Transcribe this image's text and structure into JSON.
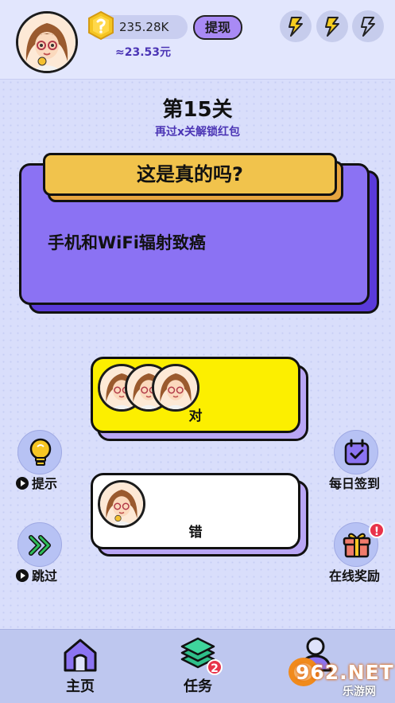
{
  "header": {
    "coin_value": "235.28K",
    "withdraw_label": "提现",
    "approx_value": "≈23.53元",
    "energy_icons": [
      "lightning-icon",
      "lightning-icon",
      "lightning-icon"
    ]
  },
  "level": {
    "title": "第15关",
    "subtitle": "再过x关解锁红包"
  },
  "question": {
    "title": "这是真的吗?",
    "text": "手机和WiFi辐射致癌"
  },
  "answers": [
    {
      "label": "对",
      "color": "#fcef00",
      "voter_count": 3
    },
    {
      "label": "错",
      "color": "#ffffff",
      "voter_count": 1
    }
  ],
  "left_actions": [
    {
      "label": "提示",
      "icon": "lightbulb-icon"
    },
    {
      "label": "跳过",
      "icon": "skip-forward-icon"
    }
  ],
  "right_actions": [
    {
      "label": "每日签到",
      "icon": "calendar-check-icon"
    },
    {
      "label": "在线奖励",
      "icon": "gift-icon",
      "badge": "!"
    }
  ],
  "nav": {
    "items": [
      {
        "label": "主页",
        "icon": "home-icon"
      },
      {
        "label": "任务",
        "icon": "layers-icon",
        "badge": "2"
      },
      {
        "label": "",
        "icon": "profile-icon"
      }
    ]
  },
  "watermark": {
    "main": "962.NET",
    "sub": "乐游网"
  },
  "colors": {
    "accent_purple": "#8b72f3",
    "title_yellow": "#f1c34c",
    "yes_yellow": "#fcef00",
    "text_purple": "#4b35b5"
  }
}
